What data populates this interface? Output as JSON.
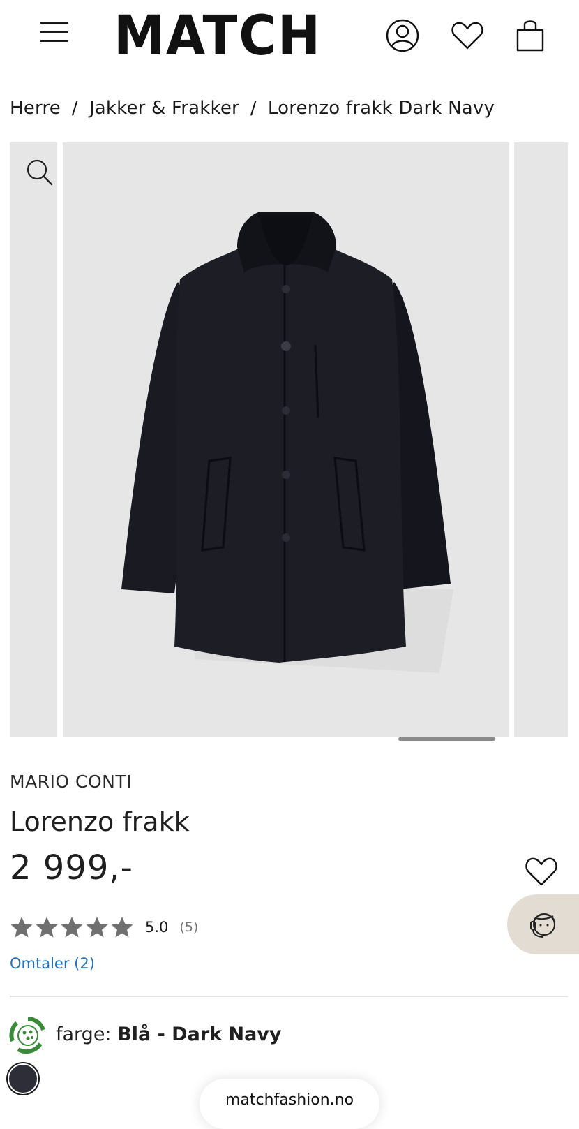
{
  "header": {
    "logo_text": "MATCH",
    "menu_icon": "hamburger-menu-icon",
    "account_icon": "user-account-icon",
    "wishlist_icon": "heart-icon",
    "cart_icon": "shopping-bag-icon"
  },
  "breadcrumb": {
    "items": [
      "Herre",
      "Jakker & Frakker",
      "Lorenzo frakk Dark Navy"
    ],
    "separator": "/"
  },
  "gallery": {
    "zoom_icon": "magnifier-icon",
    "image_subject": "dark navy coat",
    "background": "#e6e6e6"
  },
  "product": {
    "brand": "MARIO CONTI",
    "name": "Lorenzo frakk",
    "price": "2 999,-",
    "rating_score": "5.0",
    "rating_count": "(5)",
    "stars_filled": 5,
    "reviews_link": "Omtaler (2)",
    "color_label": "farge:",
    "color_value": "Blå - Dark Navy",
    "swatch_color": "#2d2e38"
  },
  "browser": {
    "url": "matchfashion.no"
  },
  "colors": {
    "link": "#2472b8",
    "chat_bg": "#e2dcd2",
    "eco_green": "#3a8a3a",
    "star": "#707070"
  }
}
